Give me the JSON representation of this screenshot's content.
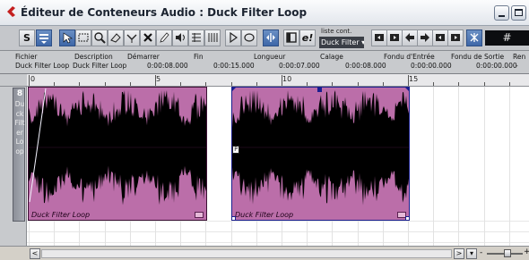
{
  "window": {
    "title": "Éditeur de Conteneurs Audio : Duck Filter Loop"
  },
  "toolbar": {
    "solo_label": "S",
    "list_label": "liste cont.",
    "list_value": "Duck Filter",
    "edit_label": "e!",
    "grid_value": "#"
  },
  "info": {
    "headers": [
      "Fichier",
      "Description",
      "Démarrer",
      "Fin",
      "Longueur",
      "Calage",
      "Fondu d'Entrée",
      "Fondu de Sortie",
      "Ren"
    ],
    "values": [
      "Duck Filter Loop",
      "Duck Filter Loop",
      "0:00:08.000",
      "0:00:15.000",
      "0:00:07.000",
      "0:00:08.000",
      "0:00:00.000",
      "0:00:00.000",
      "-"
    ]
  },
  "ruler": {
    "labels": [
      "0",
      "5",
      "10",
      "15"
    ]
  },
  "track": {
    "number": "8",
    "name": "Duck Filter Loop"
  },
  "events": [
    {
      "name": "Duck Filter Loop"
    },
    {
      "name": "Duck Filter Loop"
    }
  ],
  "colors": {
    "event_fill": "#bb6ea9",
    "selection": "#1a1f8f",
    "waveform": "#000000"
  }
}
